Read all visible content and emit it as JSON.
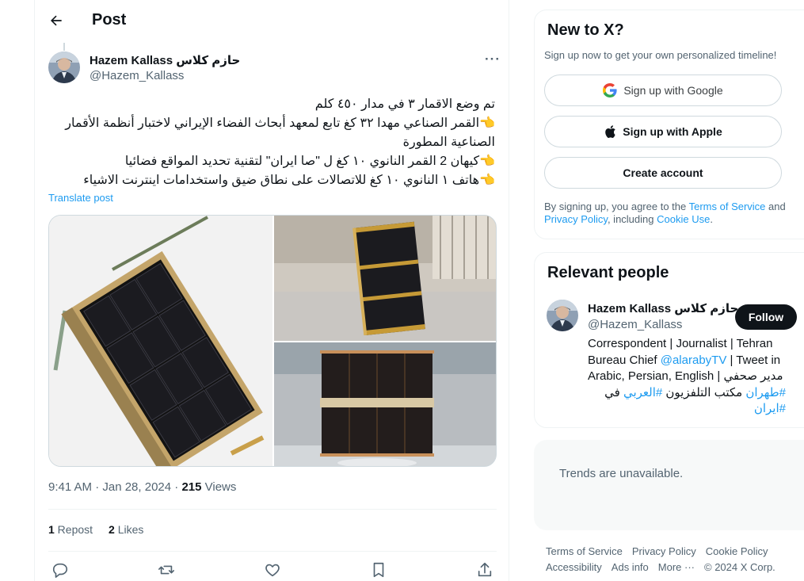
{
  "header": {
    "title": "Post"
  },
  "tweet": {
    "author_name": "Hazem Kallass حازم كلاس",
    "author_handle": "@Hazem_Kallass",
    "more": "···",
    "lines": [
      "تم وضع الاقمار ٣ في مدار ٤٥٠ كلم",
      "👈القمر الصناعي مهدا ٣٢ كغ تابع لمعهد أبحاث الفضاء الإيراني لاختبار أنظمة الأقمار الصناعية المطورة",
      "👈كيهان 2 القمر النانوي ١٠ كغ ل \"صا ايران\" لتقنية تحديد المواقع فضائيا",
      "👈هاتف ١ النانوي ١٠ كغ للاتصالات على نطاق ضيق واستخدامات اينترنت الاشياء"
    ],
    "translate": "Translate post",
    "time": "9:41 AM · Jan 28, 2024 · ",
    "views_count": "215",
    "views_label": " Views",
    "repost_count": "1",
    "repost_label": " Repost",
    "likes_count": "2",
    "likes_label": " Likes"
  },
  "new_to_x": {
    "title": "New to X?",
    "subtitle": "Sign up now to get your own personalized timeline!",
    "google": "Sign up with Google",
    "apple": "Sign up with Apple",
    "create": "Create account",
    "legal_1": "By signing up, you agree to the ",
    "terms": "Terms of Service",
    "legal_2": " and ",
    "privacy": "Privacy Policy",
    "legal_3": ", including ",
    "cookie": "Cookie Use",
    "legal_4": "."
  },
  "relevant": {
    "title": "Relevant people",
    "name": "Hazem Kallass حازم كلاس",
    "handle": "@Hazem_Kallass",
    "follow": "Follow",
    "bio_1": "Correspondent | Journalist | Tehran Bureau Chief ",
    "bio_mention": "@alarabyTV",
    "bio_2": " | Tweet in Arabic, Persian, English | مدير صحفي",
    "bio_hashtag1": "#طهران",
    "bio_3": " مكتب التلفزيون ",
    "bio_hashtag2": "#العربي",
    "bio_4": " في",
    "bio_hashtag3": "#ايران"
  },
  "trends": {
    "text": "Trends are unavailable."
  },
  "footer": {
    "terms": "Terms of Service",
    "privacy": "Privacy Policy",
    "cookie": "Cookie Policy",
    "accessibility": "Accessibility",
    "ads": "Ads info",
    "more": "More ···",
    "copyright": "© 2024 X Corp."
  },
  "colors": {
    "accent": "#1d9bf0",
    "text": "#0f1419",
    "muted": "#536471",
    "border": "#eff3f4"
  }
}
